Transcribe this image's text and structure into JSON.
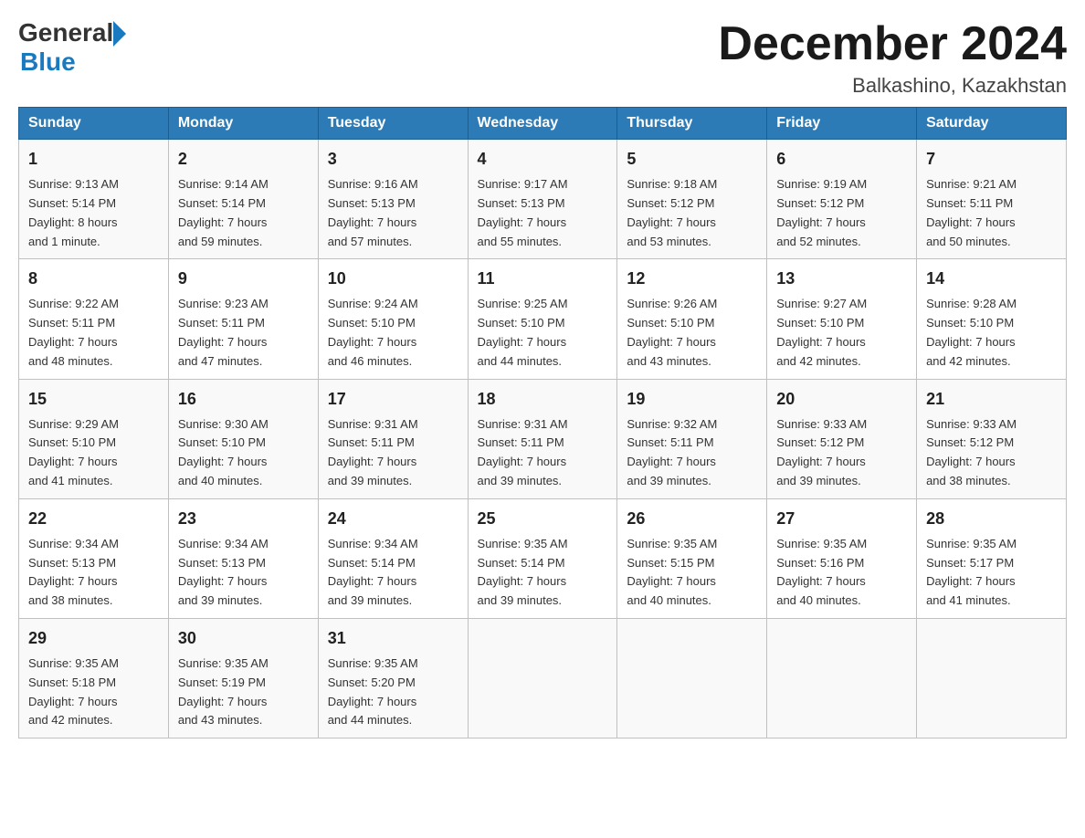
{
  "header": {
    "logo_general": "General",
    "logo_blue": "Blue",
    "month_title": "December 2024",
    "location": "Balkashino, Kazakhstan"
  },
  "columns": [
    "Sunday",
    "Monday",
    "Tuesday",
    "Wednesday",
    "Thursday",
    "Friday",
    "Saturday"
  ],
  "weeks": [
    [
      {
        "day": "1",
        "sunrise": "9:13 AM",
        "sunset": "5:14 PM",
        "daylight": "8 hours and 1 minute."
      },
      {
        "day": "2",
        "sunrise": "9:14 AM",
        "sunset": "5:14 PM",
        "daylight": "7 hours and 59 minutes."
      },
      {
        "day": "3",
        "sunrise": "9:16 AM",
        "sunset": "5:13 PM",
        "daylight": "7 hours and 57 minutes."
      },
      {
        "day": "4",
        "sunrise": "9:17 AM",
        "sunset": "5:13 PM",
        "daylight": "7 hours and 55 minutes."
      },
      {
        "day": "5",
        "sunrise": "9:18 AM",
        "sunset": "5:12 PM",
        "daylight": "7 hours and 53 minutes."
      },
      {
        "day": "6",
        "sunrise": "9:19 AM",
        "sunset": "5:12 PM",
        "daylight": "7 hours and 52 minutes."
      },
      {
        "day": "7",
        "sunrise": "9:21 AM",
        "sunset": "5:11 PM",
        "daylight": "7 hours and 50 minutes."
      }
    ],
    [
      {
        "day": "8",
        "sunrise": "9:22 AM",
        "sunset": "5:11 PM",
        "daylight": "7 hours and 48 minutes."
      },
      {
        "day": "9",
        "sunrise": "9:23 AM",
        "sunset": "5:11 PM",
        "daylight": "7 hours and 47 minutes."
      },
      {
        "day": "10",
        "sunrise": "9:24 AM",
        "sunset": "5:10 PM",
        "daylight": "7 hours and 46 minutes."
      },
      {
        "day": "11",
        "sunrise": "9:25 AM",
        "sunset": "5:10 PM",
        "daylight": "7 hours and 44 minutes."
      },
      {
        "day": "12",
        "sunrise": "9:26 AM",
        "sunset": "5:10 PM",
        "daylight": "7 hours and 43 minutes."
      },
      {
        "day": "13",
        "sunrise": "9:27 AM",
        "sunset": "5:10 PM",
        "daylight": "7 hours and 42 minutes."
      },
      {
        "day": "14",
        "sunrise": "9:28 AM",
        "sunset": "5:10 PM",
        "daylight": "7 hours and 42 minutes."
      }
    ],
    [
      {
        "day": "15",
        "sunrise": "9:29 AM",
        "sunset": "5:10 PM",
        "daylight": "7 hours and 41 minutes."
      },
      {
        "day": "16",
        "sunrise": "9:30 AM",
        "sunset": "5:10 PM",
        "daylight": "7 hours and 40 minutes."
      },
      {
        "day": "17",
        "sunrise": "9:31 AM",
        "sunset": "5:11 PM",
        "daylight": "7 hours and 39 minutes."
      },
      {
        "day": "18",
        "sunrise": "9:31 AM",
        "sunset": "5:11 PM",
        "daylight": "7 hours and 39 minutes."
      },
      {
        "day": "19",
        "sunrise": "9:32 AM",
        "sunset": "5:11 PM",
        "daylight": "7 hours and 39 minutes."
      },
      {
        "day": "20",
        "sunrise": "9:33 AM",
        "sunset": "5:12 PM",
        "daylight": "7 hours and 39 minutes."
      },
      {
        "day": "21",
        "sunrise": "9:33 AM",
        "sunset": "5:12 PM",
        "daylight": "7 hours and 38 minutes."
      }
    ],
    [
      {
        "day": "22",
        "sunrise": "9:34 AM",
        "sunset": "5:13 PM",
        "daylight": "7 hours and 38 minutes."
      },
      {
        "day": "23",
        "sunrise": "9:34 AM",
        "sunset": "5:13 PM",
        "daylight": "7 hours and 39 minutes."
      },
      {
        "day": "24",
        "sunrise": "9:34 AM",
        "sunset": "5:14 PM",
        "daylight": "7 hours and 39 minutes."
      },
      {
        "day": "25",
        "sunrise": "9:35 AM",
        "sunset": "5:14 PM",
        "daylight": "7 hours and 39 minutes."
      },
      {
        "day": "26",
        "sunrise": "9:35 AM",
        "sunset": "5:15 PM",
        "daylight": "7 hours and 40 minutes."
      },
      {
        "day": "27",
        "sunrise": "9:35 AM",
        "sunset": "5:16 PM",
        "daylight": "7 hours and 40 minutes."
      },
      {
        "day": "28",
        "sunrise": "9:35 AM",
        "sunset": "5:17 PM",
        "daylight": "7 hours and 41 minutes."
      }
    ],
    [
      {
        "day": "29",
        "sunrise": "9:35 AM",
        "sunset": "5:18 PM",
        "daylight": "7 hours and 42 minutes."
      },
      {
        "day": "30",
        "sunrise": "9:35 AM",
        "sunset": "5:19 PM",
        "daylight": "7 hours and 43 minutes."
      },
      {
        "day": "31",
        "sunrise": "9:35 AM",
        "sunset": "5:20 PM",
        "daylight": "7 hours and 44 minutes."
      },
      null,
      null,
      null,
      null
    ]
  ],
  "labels": {
    "sunrise": "Sunrise:",
    "sunset": "Sunset:",
    "daylight": "Daylight:"
  }
}
